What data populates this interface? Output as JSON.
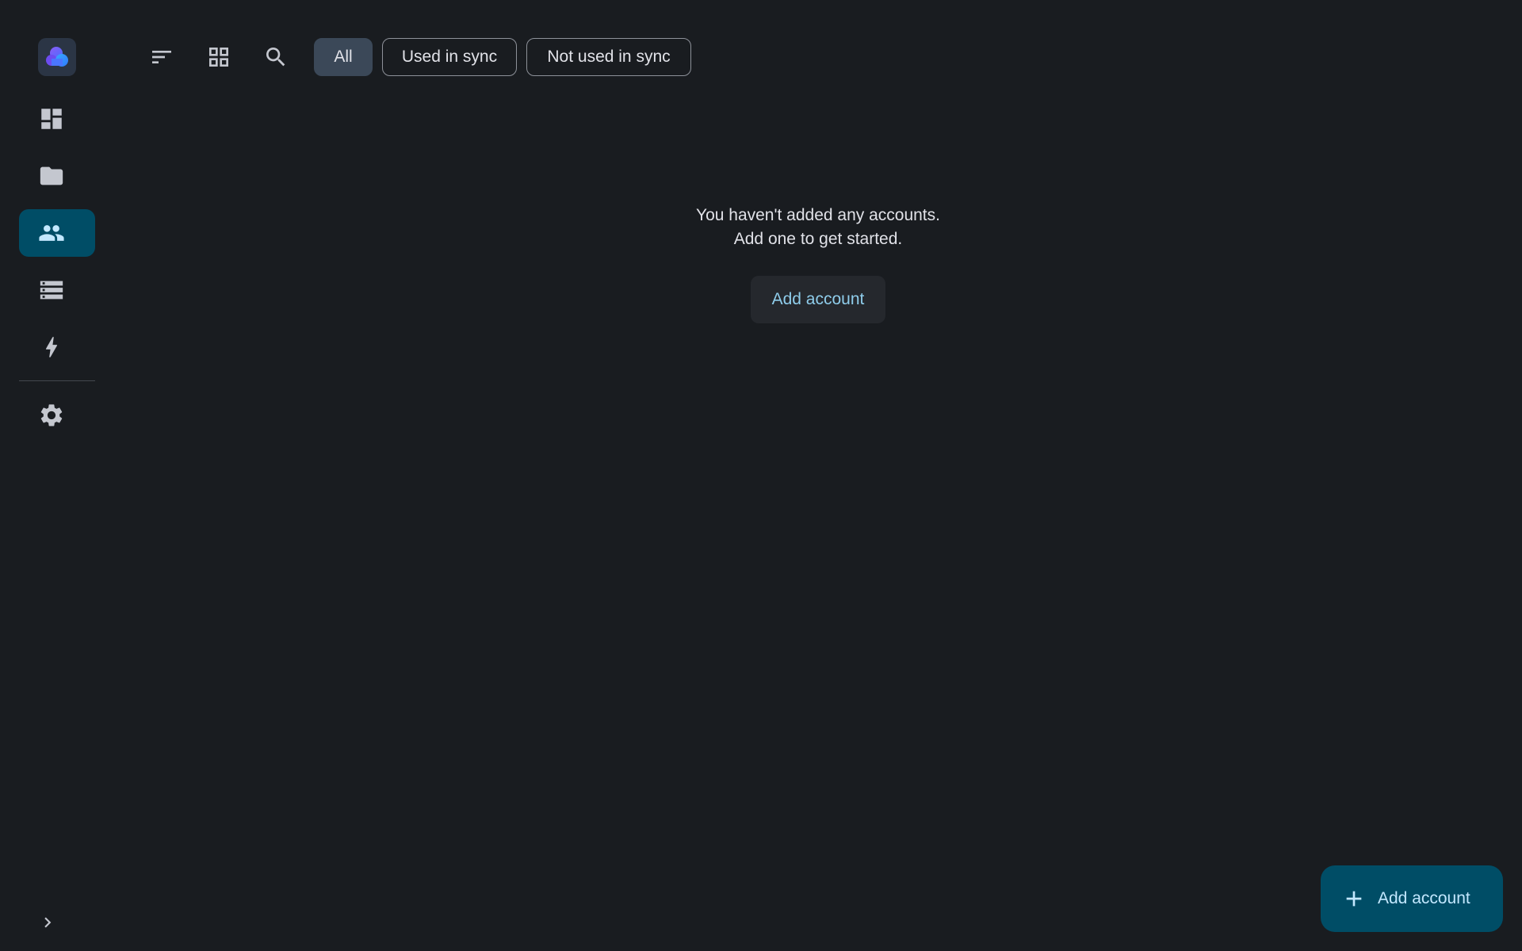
{
  "sidebar": {
    "logo_icon": "cloud-logo-icon",
    "items": [
      {
        "id": "dashboard",
        "icon": "dashboard-icon",
        "active": false
      },
      {
        "id": "files",
        "icon": "folder-icon",
        "active": false
      },
      {
        "id": "accounts",
        "icon": "people-icon",
        "active": true
      },
      {
        "id": "storage",
        "icon": "storage-icon",
        "active": false
      },
      {
        "id": "jobs",
        "icon": "lightning-icon",
        "active": false
      },
      {
        "id": "settings",
        "icon": "gear-icon",
        "active": false
      }
    ],
    "expand_icon": "chevron-right-icon"
  },
  "toolbar": {
    "icons": [
      "sort-icon",
      "grid-view-icon",
      "search-icon"
    ],
    "filters": [
      {
        "label": "All",
        "selected": true
      },
      {
        "label": "Used in sync",
        "selected": false
      },
      {
        "label": "Not used in sync",
        "selected": false
      }
    ]
  },
  "empty_state": {
    "line1": "You haven't added any accounts.",
    "line2": "Add one to get started.",
    "button_label": "Add account"
  },
  "fab": {
    "label": "Add account",
    "icon": "plus-icon"
  },
  "colors": {
    "background": "#191c20",
    "accent": "#004d66",
    "accent_text": "#c3e8ff",
    "link_text": "#8fcdeb",
    "chip_selected": "#3b4858"
  }
}
